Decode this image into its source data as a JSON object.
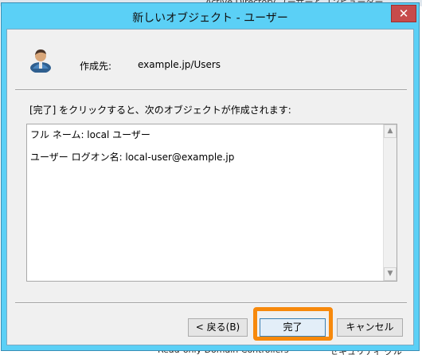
{
  "background": {
    "window_title": "Active Directory ユーザーとコンピューター",
    "bottom_left": "Read-only Domain Controllers",
    "bottom_right": "セキュリティ グル"
  },
  "dialog": {
    "title": "新しいオブジェクト - ユーザー",
    "close_glyph": "✕",
    "create_in_label": "作成先:",
    "create_in_value": "example.jp/Users",
    "instruction": "[完了] をクリックすると、次のオブジェクトが作成されます:",
    "summary": [
      "フル ネーム: local ユーザー",
      "ユーザー ログオン名: local-user@example.jp"
    ],
    "scroll_up_glyph": "▲",
    "scroll_down_glyph": "▼",
    "buttons": {
      "back": "< 戻る(B)",
      "finish": "完了",
      "cancel": "キャンセル"
    },
    "highlight_color": "#f7890c",
    "titlebar_color": "#5bd0f6"
  },
  "icons": {
    "object_icon": "user-icon",
    "close": "close-icon"
  }
}
